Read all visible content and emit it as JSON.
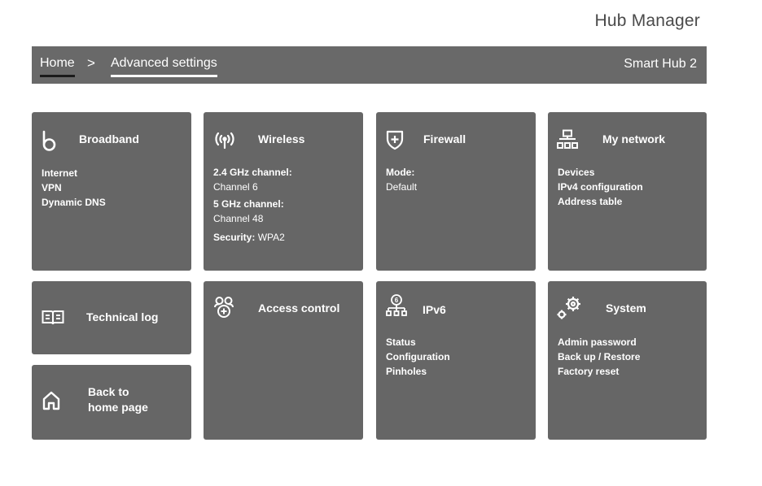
{
  "header": {
    "app_title": "Hub Manager"
  },
  "breadcrumb": {
    "home": "Home",
    "separator": ">",
    "current": "Advanced settings",
    "device": "Smart Hub 2"
  },
  "tiles": {
    "broadband": {
      "title": "Broadband",
      "icon": "broadband-icon",
      "items": [
        "Internet",
        "VPN",
        "Dynamic DNS"
      ]
    },
    "wireless": {
      "title": "Wireless",
      "icon": "wireless-icon",
      "ch24_label": "2.4 GHz channel:",
      "ch24_value": "Channel 6",
      "ch5_label": "5 GHz channel:",
      "ch5_value": "Channel 48",
      "security_label": "Security:",
      "security_value": "WPA2"
    },
    "firewall": {
      "title": "Firewall",
      "icon": "shield-icon",
      "mode_label": "Mode:",
      "mode_value": "Default"
    },
    "my_network": {
      "title": "My network",
      "icon": "network-icon",
      "items": [
        "Devices",
        "IPv4 configuration",
        "Address table"
      ]
    },
    "technical_log": {
      "title": "Technical log",
      "icon": "book-icon"
    },
    "access_control": {
      "title": "Access control",
      "icon": "access-control-icon"
    },
    "ipv6": {
      "title": "IPv6",
      "icon": "ipv6-network-icon",
      "items": [
        "Status",
        "Configuration",
        "Pinholes"
      ]
    },
    "system": {
      "title": "System",
      "icon": "gears-icon",
      "items": [
        "Admin password",
        "Back up / Restore",
        "Factory reset"
      ]
    },
    "back_home": {
      "title_line1": "Back to",
      "title_line2": "home page",
      "icon": "home-icon"
    }
  },
  "colors": {
    "tile": "#666666",
    "navbar": "#696969",
    "text_dark": "#4a4a4a"
  }
}
